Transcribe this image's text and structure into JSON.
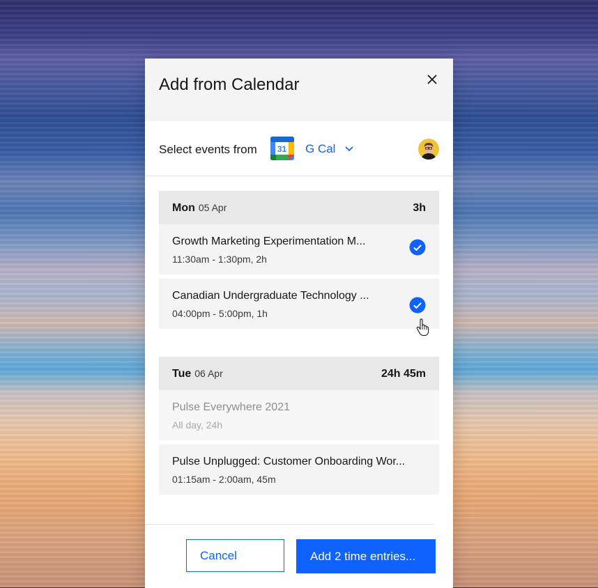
{
  "modal": {
    "title": "Add from Calendar",
    "close_icon": "close-icon"
  },
  "source": {
    "label": "Select events from",
    "calendar_icon": "google-calendar-icon",
    "calendar_icon_text": "31",
    "calendar_name": "G Cal",
    "dropdown_icon": "chevron-down-icon",
    "avatar_icon": "user-avatar"
  },
  "days": [
    {
      "day": "Mon",
      "date": "05 Apr",
      "total": "3h",
      "events": [
        {
          "title": "Growth Marketing Experimentation M...",
          "time": "11:30am - 1:30pm, 2h",
          "checked": true
        },
        {
          "title": "Canadian Undergraduate Technology ...",
          "time": "04:00pm - 5:00pm, 1h",
          "checked": true
        }
      ]
    },
    {
      "day": "Tue",
      "date": "06 Apr",
      "total": "24h 45m",
      "events": [
        {
          "title": "Pulse Everywhere 2021",
          "time": "All day, 24h",
          "checked": false,
          "disabled": true
        },
        {
          "title": "Pulse Unplugged: Customer Onboarding Wor...",
          "time": "01:15am - 2:00am, 45m",
          "checked": false
        }
      ]
    }
  ],
  "footer": {
    "cancel_label": "Cancel",
    "primary_label": "Add 2 time entries..."
  },
  "colors": {
    "accent": "#0f62fe",
    "header_bg": "#f4f4f4",
    "day_header_bg": "#e8e8e8"
  }
}
